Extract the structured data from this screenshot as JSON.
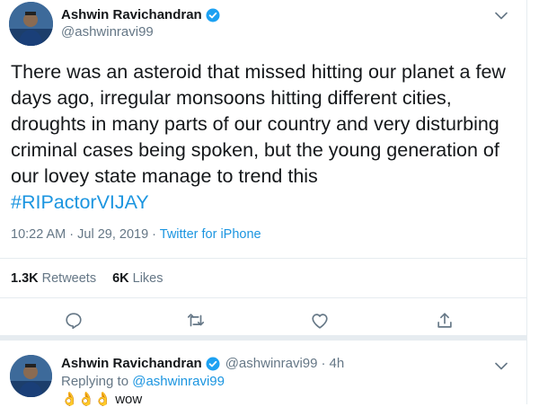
{
  "main_tweet": {
    "author": {
      "name": "Ashwin Ravichandran",
      "handle": "@ashwinravi99",
      "verified_icon": "verified-badge-icon"
    },
    "text": "There was an asteroid that missed hitting our planet a few days ago, irregular monsoons hitting different cities, droughts in many parts of our country and very disturbing criminal cases being spoken, but the young generation of our lovey state manage to trend this",
    "hashtag": "#RIPactorVIJAY",
    "timestamp": "10:22 AM · Jul 29, 2019",
    "separator": " · ",
    "source": "Twitter for iPhone",
    "stats": {
      "retweets_count": "1.3K",
      "retweets_label": "Retweets",
      "likes_count": "6K",
      "likes_label": "Likes"
    },
    "actions": [
      "reply-icon",
      "retweet-icon",
      "like-icon",
      "share-icon"
    ]
  },
  "reply_tweet": {
    "author": {
      "name": "Ashwin Ravichandran",
      "handle": "@ashwinravi99",
      "time": "4h"
    },
    "dot": "·",
    "replying_prefix": "Replying to",
    "replying_to": "@ashwinravi99",
    "text": "👌👌👌 wow"
  },
  "colors": {
    "link": "#1b95e0",
    "secondary_text": "#657786",
    "divider": "#e6ecf0",
    "verified": "#1da1f2"
  }
}
